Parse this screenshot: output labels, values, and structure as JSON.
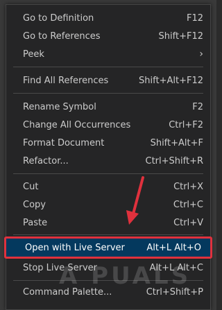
{
  "menu": {
    "items": [
      {
        "label": "Go to Definition",
        "shortcut": "F12"
      },
      {
        "label": "Go to References",
        "shortcut": "Shift+F12"
      },
      {
        "label": "Peek",
        "shortcut": ""
      },
      {
        "label": "Find All References",
        "shortcut": "Shift+Alt+F12"
      },
      {
        "label": "Rename Symbol",
        "shortcut": "F2"
      },
      {
        "label": "Change All Occurrences",
        "shortcut": "Ctrl+F2"
      },
      {
        "label": "Format Document",
        "shortcut": "Shift+Alt+F"
      },
      {
        "label": "Refactor...",
        "shortcut": "Ctrl+Shift+R"
      },
      {
        "label": "Cut",
        "shortcut": "Ctrl+X"
      },
      {
        "label": "Copy",
        "shortcut": "Ctrl+C"
      },
      {
        "label": "Paste",
        "shortcut": "Ctrl+V"
      },
      {
        "label": "Open with Live Server",
        "shortcut": "Alt+L Alt+O"
      },
      {
        "label": "Stop Live Server",
        "shortcut": "Alt+L Alt+C"
      },
      {
        "label": "Command Palette...",
        "shortcut": "Ctrl+Shift+P"
      }
    ],
    "submenu_indicator": "›"
  },
  "watermark": "A PUALS",
  "colors": {
    "highlight_bg": "#04395e",
    "highlight_border": "#e0313d",
    "arrow": "#e0313d",
    "menu_bg": "#252526"
  }
}
